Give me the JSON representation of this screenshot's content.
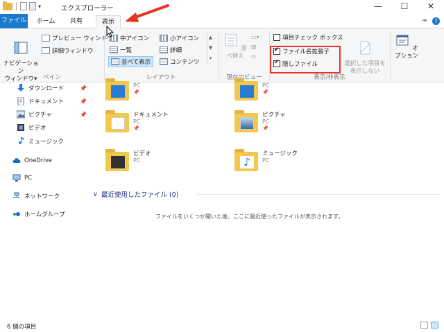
{
  "window": {
    "title": "エクスプローラー",
    "minimize": "—",
    "maximize": "☐",
    "close": "✕"
  },
  "tabs": {
    "file": "ファイル",
    "home": "ホーム",
    "share": "共有",
    "view": "表示"
  },
  "ribbon": {
    "pane": {
      "nav_pane": "ナビゲーション\nウィンドウ▾",
      "preview": "プレビュー ウィンドウ",
      "details": "詳細ウィンドウ",
      "label": "ペイン"
    },
    "layout": {
      "medium_icons": "中アイコン",
      "small_icons": "小アイコン",
      "list": "一覧",
      "details": "詳細",
      "tiles": "並べて表示",
      "content": "コンテンツ",
      "label": "レイアウト"
    },
    "current_view": {
      "sort": "並べ替え",
      "label": "現在のビュー"
    },
    "show_hide": {
      "item_checkboxes": "項目チェック ボックス",
      "file_extensions": "ファイル名拡張子",
      "hidden_items": "隠しファイル",
      "hide_selected": "選択した項目を\n表示しない",
      "label": "表示/非表示"
    },
    "options": "オプション"
  },
  "nav": {
    "downloads": "ダウンロード",
    "documents": "ドキュメント",
    "pictures": "ピクチャ",
    "videos": "ビデオ",
    "music": "ミュージック",
    "onedrive": "OneDrive",
    "pc": "PC",
    "network": "ネットワーク",
    "homegroup": "ホームグループ"
  },
  "folders": [
    {
      "name": "",
      "sub": "PC"
    },
    {
      "name": "",
      "sub": "PC"
    },
    {
      "name": "ドキュメント",
      "sub": "PC"
    },
    {
      "name": "ピクチャ",
      "sub": "PC"
    },
    {
      "name": "ビデオ",
      "sub": "PC"
    },
    {
      "name": "ミュージック",
      "sub": "PC"
    }
  ],
  "recent": {
    "header": "最近使用したファイル (0)",
    "empty_message": "ファイルをいくつか開いた後、ここに最近使ったファイルが表示されます。"
  },
  "status": {
    "count": "6 個の項目"
  },
  "colors": {
    "accent": "#1979ca",
    "highlight_box": "#e8321e",
    "arrow": "#e8321e"
  }
}
